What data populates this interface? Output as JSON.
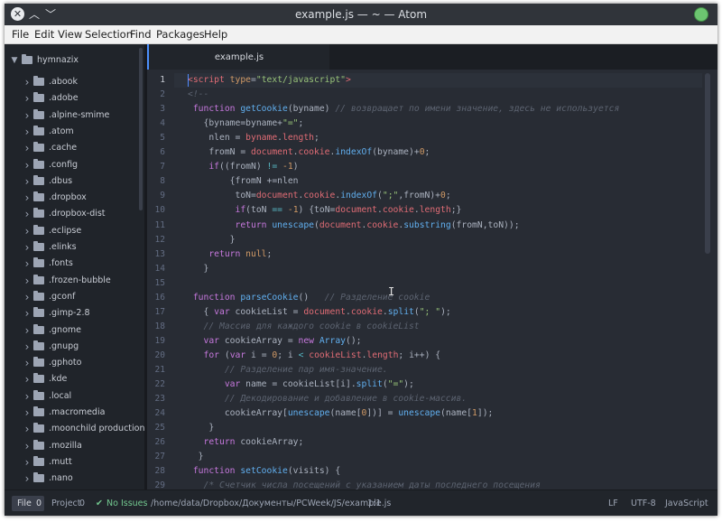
{
  "window": {
    "title": "example.js — ~ — Atom"
  },
  "menu": [
    "File",
    "Edit",
    "View",
    "Selection",
    "Find",
    "Packages",
    "Help"
  ],
  "tree": {
    "root": "hymnazix",
    "items": [
      ".abook",
      ".adobe",
      ".alpine-smime",
      ".atom",
      ".cache",
      ".config",
      ".dbus",
      ".dropbox",
      ".dropbox-dist",
      ".eclipse",
      ".elinks",
      ".fonts",
      ".frozen-bubble",
      ".gconf",
      ".gimp-2.8",
      ".gnome",
      ".gnupg",
      ".gphoto",
      ".kde",
      ".local",
      ".macromedia",
      ".moonchild productions",
      ".mozilla",
      ".mutt",
      ".nano"
    ]
  },
  "tab": {
    "label": "example.js"
  },
  "editor": {
    "active_line": 1,
    "lines": [
      [
        [
          "<",
          "t-tag"
        ],
        [
          "script ",
          "t-tag"
        ],
        [
          "type",
          "t-attr"
        ],
        [
          "=",
          ""
        ],
        [
          "\"text/javascript\"",
          "t-str"
        ],
        [
          ">",
          "t-tag"
        ]
      ],
      [
        [
          "<!--",
          "t-cm"
        ]
      ],
      [
        [
          " function ",
          "t-kw"
        ],
        [
          "getCookie",
          "t-fn"
        ],
        [
          "(byname) ",
          ""
        ],
        [
          "// возвращает по имени значение, здесь не используется",
          "t-cm"
        ]
      ],
      [
        [
          "   {byname=byname+",
          ""
        ],
        [
          "\"=\"",
          "t-str"
        ],
        [
          ";",
          ""
        ]
      ],
      [
        [
          "    nlen = ",
          ""
        ],
        [
          "byname",
          "t-prop"
        ],
        [
          ".",
          ""
        ],
        [
          "length",
          "t-prop"
        ],
        [
          ";",
          ""
        ]
      ],
      [
        [
          "    fromN = ",
          ""
        ],
        [
          "document",
          "t-prop"
        ],
        [
          ".",
          ""
        ],
        [
          "cookie",
          "t-prop"
        ],
        [
          ".",
          ""
        ],
        [
          "indexOf",
          "t-fn"
        ],
        [
          "(byname)+",
          ""
        ],
        [
          "0",
          "t-num"
        ],
        [
          ";",
          ""
        ]
      ],
      [
        [
          "    ",
          ""
        ],
        [
          "if",
          "t-kw"
        ],
        [
          "((fromN) ",
          ""
        ],
        [
          "!=",
          "t-op"
        ],
        [
          " ",
          ""
        ],
        [
          "-1",
          "t-num"
        ],
        [
          ")",
          ""
        ]
      ],
      [
        [
          "        {fromN +=nlen",
          ""
        ]
      ],
      [
        [
          "         toN=",
          ""
        ],
        [
          "document",
          "t-prop"
        ],
        [
          ".",
          ""
        ],
        [
          "cookie",
          "t-prop"
        ],
        [
          ".",
          ""
        ],
        [
          "indexOf",
          "t-fn"
        ],
        [
          "(",
          ""
        ],
        [
          "\";\"",
          "t-str"
        ],
        [
          ",fromN)+",
          ""
        ],
        [
          "0",
          "t-num"
        ],
        [
          ";",
          ""
        ]
      ],
      [
        [
          "         ",
          ""
        ],
        [
          "if",
          "t-kw"
        ],
        [
          "(toN ",
          ""
        ],
        [
          "==",
          "t-op"
        ],
        [
          " ",
          ""
        ],
        [
          "-1",
          "t-num"
        ],
        [
          ") {toN=",
          ""
        ],
        [
          "document",
          "t-prop"
        ],
        [
          ".",
          ""
        ],
        [
          "cookie",
          "t-prop"
        ],
        [
          ".",
          ""
        ],
        [
          "length",
          "t-prop"
        ],
        [
          ";}",
          ""
        ]
      ],
      [
        [
          "         ",
          ""
        ],
        [
          "return ",
          "t-kw"
        ],
        [
          "unescape",
          "t-fn"
        ],
        [
          "(",
          ""
        ],
        [
          "document",
          "t-prop"
        ],
        [
          ".",
          ""
        ],
        [
          "cookie",
          "t-prop"
        ],
        [
          ".",
          ""
        ],
        [
          "substring",
          "t-fn"
        ],
        [
          "(fromN,toN));",
          ""
        ]
      ],
      [
        [
          "        }",
          ""
        ]
      ],
      [
        [
          "    ",
          ""
        ],
        [
          "return ",
          "t-kw"
        ],
        [
          "null",
          "t-num"
        ],
        [
          ";",
          ""
        ]
      ],
      [
        [
          "   }",
          ""
        ]
      ],
      [
        [
          "",
          ""
        ]
      ],
      [
        [
          " function ",
          "t-kw"
        ],
        [
          "parseCookie",
          "t-fn"
        ],
        [
          "()   ",
          ""
        ],
        [
          "// Разделение cookie",
          "t-cm"
        ]
      ],
      [
        [
          "   { ",
          ""
        ],
        [
          "var ",
          "t-kw"
        ],
        [
          "cookieList = ",
          ""
        ],
        [
          "document",
          "t-prop"
        ],
        [
          ".",
          ""
        ],
        [
          "cookie",
          "t-prop"
        ],
        [
          ".",
          ""
        ],
        [
          "split",
          "t-fn"
        ],
        [
          "(",
          ""
        ],
        [
          "\"; \"",
          "t-str"
        ],
        [
          ");",
          ""
        ]
      ],
      [
        [
          "   ",
          ""
        ],
        [
          "// Массив для каждого cookie в cookieList",
          "t-cm"
        ]
      ],
      [
        [
          "   ",
          ""
        ],
        [
          "var ",
          "t-kw"
        ],
        [
          "cookieArray = ",
          ""
        ],
        [
          "new ",
          "t-kw"
        ],
        [
          "Array",
          "t-fn"
        ],
        [
          "();",
          ""
        ]
      ],
      [
        [
          "   ",
          ""
        ],
        [
          "for ",
          "t-kw"
        ],
        [
          "(",
          ""
        ],
        [
          "var ",
          "t-kw"
        ],
        [
          "i = ",
          ""
        ],
        [
          "0",
          "t-num"
        ],
        [
          "; i ",
          ""
        ],
        [
          "<",
          "t-op"
        ],
        [
          " ",
          ""
        ],
        [
          "cookieList",
          "t-prop"
        ],
        [
          ".",
          ""
        ],
        [
          "length",
          "t-prop"
        ],
        [
          "; i++) {",
          ""
        ]
      ],
      [
        [
          "       ",
          ""
        ],
        [
          "// Разделение пар имя-значение.",
          "t-cm"
        ]
      ],
      [
        [
          "       ",
          ""
        ],
        [
          "var ",
          "t-kw"
        ],
        [
          "name = cookieList[i].",
          ""
        ],
        [
          "split",
          "t-fn"
        ],
        [
          "(",
          ""
        ],
        [
          "\"=\"",
          "t-str"
        ],
        [
          ");",
          ""
        ]
      ],
      [
        [
          "       ",
          ""
        ],
        [
          "// Декодирование и добавление в cookie-массив.",
          "t-cm"
        ]
      ],
      [
        [
          "       cookieArray[",
          ""
        ],
        [
          "unescape",
          "t-fn"
        ],
        [
          "(name[",
          ""
        ],
        [
          "0",
          "t-num"
        ],
        [
          "])] = ",
          ""
        ],
        [
          "unescape",
          "t-fn"
        ],
        [
          "(name[",
          ""
        ],
        [
          "1",
          "t-num"
        ],
        [
          "]);",
          ""
        ]
      ],
      [
        [
          "    }",
          ""
        ]
      ],
      [
        [
          "   ",
          ""
        ],
        [
          "return ",
          "t-kw"
        ],
        [
          "cookieArray;",
          ""
        ]
      ],
      [
        [
          "  }",
          ""
        ]
      ],
      [
        [
          " function ",
          "t-kw"
        ],
        [
          "setCookie",
          "t-fn"
        ],
        [
          "(visits) {",
          ""
        ]
      ],
      [
        [
          "   ",
          ""
        ],
        [
          "/* Счетчик числа посещений с указанием даты последнего посещения",
          "t-cm"
        ]
      ]
    ]
  },
  "status": {
    "file_tab": "File",
    "file_count": "0",
    "project_tab": "Project",
    "project_count": "0",
    "issues": "No Issues",
    "path": "/home/data/Dropbox/Документы/PCWeek/JS/example.js",
    "position": "1:1",
    "line_ending": "LF",
    "encoding": "UTF-8",
    "grammar": "JavaScript"
  },
  "colors": {
    "editor_bg": "#282c34",
    "accent": "#4c8ffb",
    "ok": "#73c990"
  }
}
